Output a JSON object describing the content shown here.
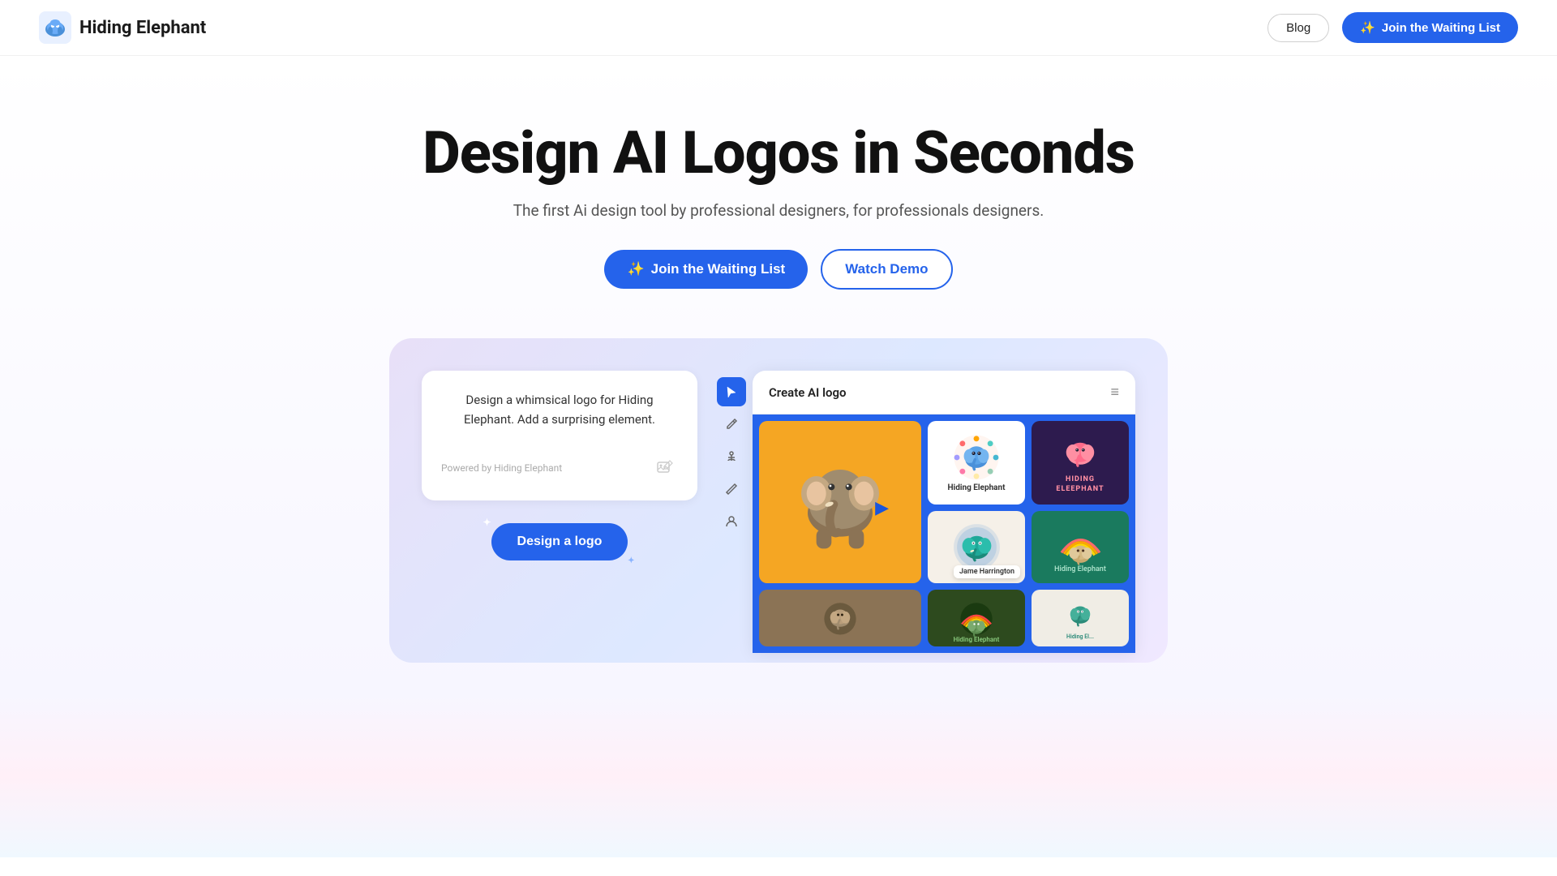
{
  "nav": {
    "brand": "Hiding Elephant",
    "blog_label": "Blog",
    "waiting_list_label": "Join the Waiting List",
    "magic_icon": "✨"
  },
  "hero": {
    "title": "Design AI Logos in Seconds",
    "subtitle": "The first Ai design tool by professional designers, for professionals designers.",
    "btn_waiting": "Join the Waiting List",
    "btn_demo": "Watch Demo",
    "magic_icon": "✨"
  },
  "chat_panel": {
    "prompt_text": "Design a whimsical logo for Hiding Elephant. Add a surprising element.",
    "powered_text": "Powered by Hiding Elephant",
    "design_btn": "Design a logo"
  },
  "logo_grid": {
    "title": "Create AI logo",
    "menu_icon": "≡",
    "tooltip": "Jame Harrington"
  },
  "toolbar": {
    "tools": [
      "cursor",
      "pen",
      "anchor",
      "pencil",
      "user"
    ]
  }
}
